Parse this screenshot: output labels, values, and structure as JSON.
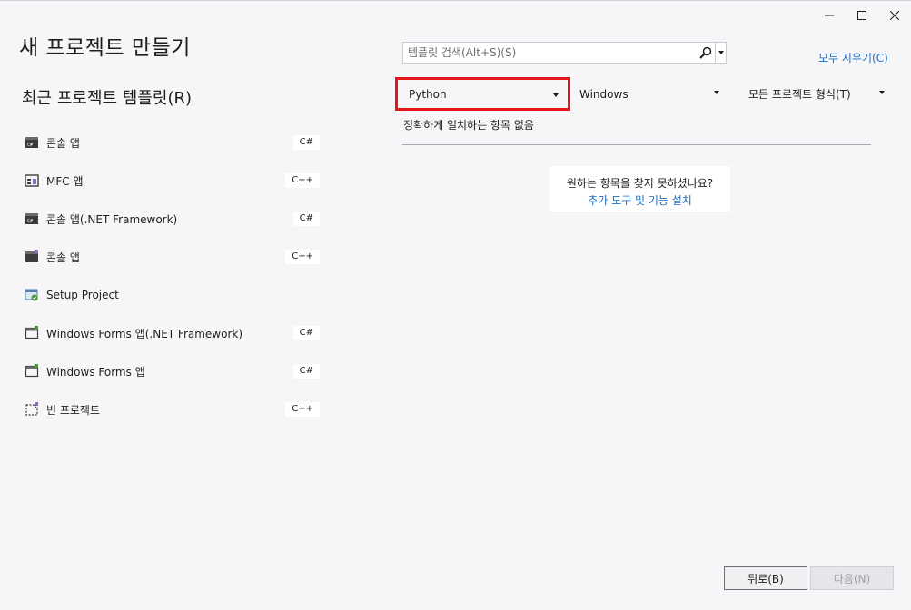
{
  "window": {
    "controls": [
      "minimize",
      "maximize",
      "close"
    ]
  },
  "page": {
    "title": "새 프로젝트 만들기"
  },
  "recent": {
    "title": "최근 프로젝트 템플릿(R)",
    "items": [
      {
        "label": "콘솔 앱",
        "lang": "C#",
        "icon": "console-app-icon"
      },
      {
        "label": "MFC 앱",
        "lang": "C++",
        "icon": "mfc-app-icon"
      },
      {
        "label": "콘솔 앱(.NET Framework)",
        "lang": "C#",
        "icon": "console-app-icon"
      },
      {
        "label": "콘솔 앱",
        "lang": "C++",
        "icon": "console-app-icon"
      },
      {
        "label": "Setup Project",
        "lang": "",
        "icon": "setup-project-icon"
      },
      {
        "label": "Windows Forms 앱(.NET Framework)",
        "lang": "C#",
        "icon": "windows-forms-icon"
      },
      {
        "label": "Windows Forms 앱",
        "lang": "C#",
        "icon": "windows-forms-icon"
      },
      {
        "label": "빈 프로젝트",
        "lang": "C++",
        "icon": "empty-project-icon"
      }
    ]
  },
  "search": {
    "placeholder": "템플릿 검색(Alt+S)(S)",
    "value": ""
  },
  "clear_all": "모두 지우기(C)",
  "filters": {
    "language": "Python",
    "platform": "Windows",
    "project_type": "모든 프로젝트 형식(T)"
  },
  "results": {
    "empty_text": "정확하게 일치하는 항목 없음",
    "help_question": "원하는 항목을 찾지 못하셨나요?",
    "help_link": "추가 도구 및 기능 설치"
  },
  "buttons": {
    "back": "뒤로(B)",
    "next": "다음(N)"
  },
  "colors": {
    "highlight_border": "#e3161b",
    "link": "#1b6cc2",
    "background": "#f6f6f8"
  }
}
